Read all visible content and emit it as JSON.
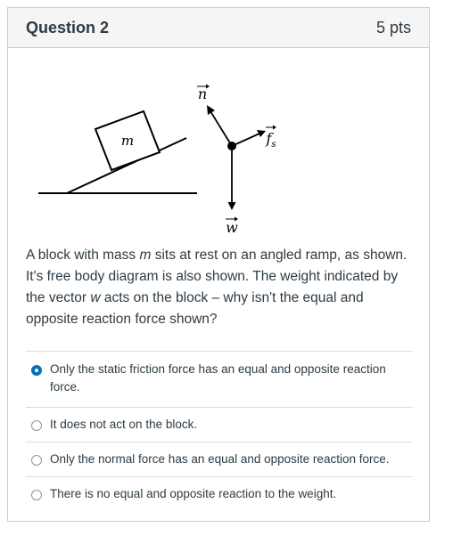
{
  "question": {
    "title": "Question 2",
    "points": "5 pts"
  },
  "diagram": {
    "block_label": "m",
    "normal_label": "n",
    "friction_label": "f",
    "friction_subscript": "s",
    "weight_label": "w"
  },
  "question_text": {
    "part1": "A block with mass ",
    "mass_var": "m",
    "part2": " sits at rest on an angled ramp, as shown. It's free body diagram is also shown. The weight indicated by the vector ",
    "weight_var": "w",
    "part3": " acts on the block – why isn't the equal and opposite reaction force shown?"
  },
  "answers": [
    {
      "label": "Only the static friction force has an equal and opposite reaction force.",
      "selected": true
    },
    {
      "label": "It does not act on the block.",
      "selected": false
    },
    {
      "label": "Only the normal force has an equal and opposite reaction force.",
      "selected": false
    },
    {
      "label": "There is no equal and opposite reaction to the weight.",
      "selected": false
    }
  ],
  "colors": {
    "accent": "#0374b5",
    "text": "#2d3b45",
    "header_bg": "#f5f5f5"
  }
}
